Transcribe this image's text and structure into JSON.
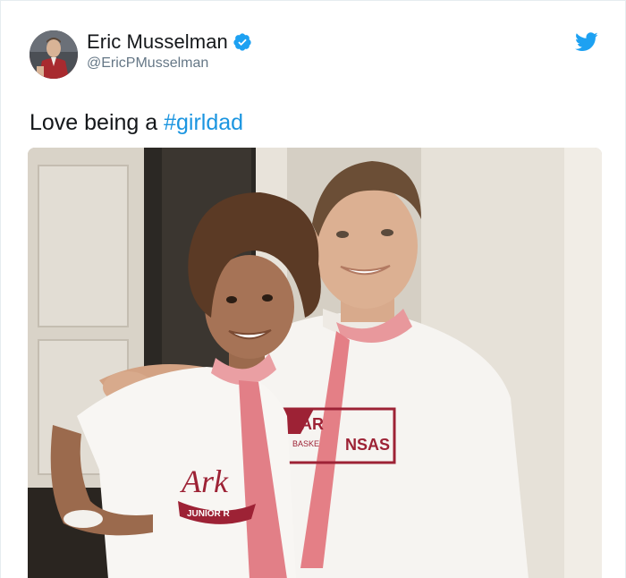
{
  "tweet": {
    "author": {
      "display_name": "Eric Musselman",
      "handle": "@EricPMusselman",
      "verified": true
    },
    "text_prefix": "Love being a ",
    "hashtag": "#girldad",
    "media": {
      "shirt_text_dad_top": "AR",
      "shirt_text_dad_right": "NSAS",
      "shirt_text_dad_small": "BASKE",
      "shirt_text_girl_script": "Ark",
      "shirt_text_girl_small": "JUNIOR R"
    }
  },
  "icons": {
    "verified": "verified-badge-icon",
    "brand": "twitter-bird-icon"
  },
  "colors": {
    "link": "#1b95e0",
    "verified": "#1da1f2",
    "brand": "#1da1f2",
    "name": "#14171a",
    "handle": "#657786",
    "razorback_red": "#9d2235"
  }
}
